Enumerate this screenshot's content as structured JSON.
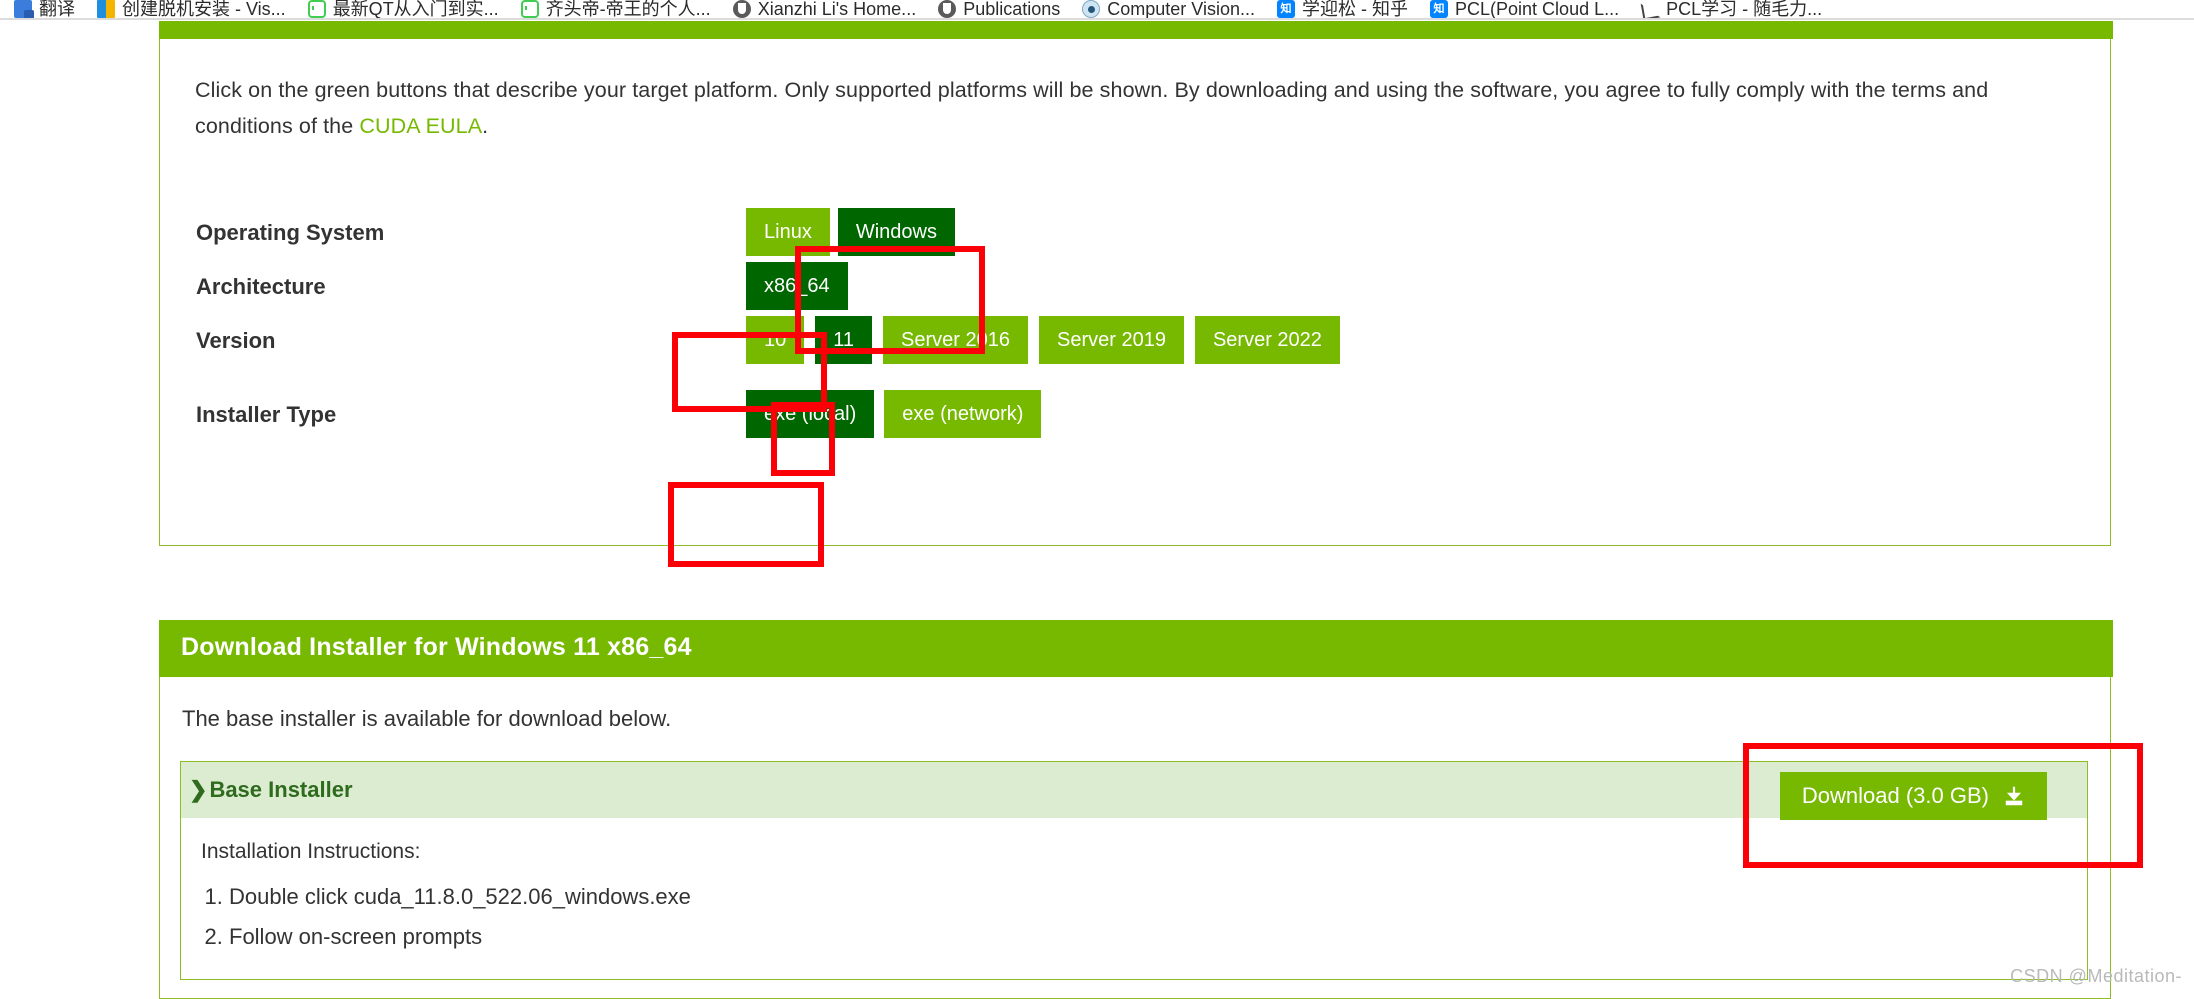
{
  "browser": {
    "bookmarks": [
      {
        "label": "翻译",
        "icon": "translate-icon"
      },
      {
        "label": "创建脱机安装 - Vis...",
        "icon": "visual-studio-icon"
      },
      {
        "label": "最新QT从入门到实...",
        "icon": "qt-icon"
      },
      {
        "label": "齐头帝-帝王的个人...",
        "icon": "qt-icon"
      },
      {
        "label": "Xianzhi Li's Home...",
        "icon": "shield-icon"
      },
      {
        "label": "Publications",
        "icon": "shield-icon"
      },
      {
        "label": "Computer Vision...",
        "icon": "eye-icon"
      },
      {
        "label": "学迎松 - 知乎",
        "icon": "zhihu-icon"
      },
      {
        "label": "PCL(Point Cloud L...",
        "icon": "zhihu-icon"
      },
      {
        "label": "PCL学习 - 随毛力...",
        "icon": "pen-icon"
      }
    ],
    "zhihu_glyph": "知"
  },
  "selector": {
    "intro_text_before": "Click on the green buttons that describe your target platform. Only supported platforms will be shown. By downloading and using the software, you agree to fully comply with the terms and conditions of the ",
    "intro_link": "CUDA EULA",
    "intro_text_after": ".",
    "rows": [
      {
        "label": "Operating System",
        "options": [
          {
            "label": "Linux",
            "selected": false
          },
          {
            "label": "Windows",
            "selected": true
          }
        ]
      },
      {
        "label": "Architecture",
        "options": [
          {
            "label": "x86_64",
            "selected": true
          }
        ]
      },
      {
        "label": "Version",
        "options": [
          {
            "label": "10",
            "selected": false
          },
          {
            "label": "11",
            "selected": true
          },
          {
            "label": "Server 2016",
            "selected": false
          },
          {
            "label": "Server 2019",
            "selected": false
          },
          {
            "label": "Server 2022",
            "selected": false
          }
        ]
      },
      {
        "label": "Installer Type",
        "options": [
          {
            "label": "exe (local)",
            "selected": true
          },
          {
            "label": "exe (network)",
            "selected": false
          }
        ]
      }
    ]
  },
  "download": {
    "panel_title": "Download Installer for Windows 11 x86_64",
    "availability_text": "The base installer is available for download below.",
    "installer_chevron": "❯",
    "installer_name": "Base Installer",
    "download_button_label": "Download (3.0 GB)",
    "download_icon": "download-tray-icon",
    "instructions_heading": "Installation Instructions:",
    "instructions": [
      "Double click cuda_11.8.0_522.06_windows.exe",
      "Follow on-screen prompts"
    ]
  },
  "annotations": {
    "color": "#fb0007",
    "boxes": [
      {
        "name": "windows-option",
        "target": "Windows"
      },
      {
        "name": "architecture-option",
        "target": "x86_64"
      },
      {
        "name": "version-option",
        "target": "11"
      },
      {
        "name": "installer-type-option",
        "target": "exe (local)"
      },
      {
        "name": "download-button",
        "target": "Download (3.0 GB)"
      }
    ]
  },
  "watermark": "CSDN @Meditation-",
  "colors": {
    "nvidia_green": "#76b900",
    "selected_green": "#006600",
    "panel_border": "#8cbf26",
    "installer_row_bg": "#dcecd0",
    "annotation_red": "#fb0007"
  }
}
